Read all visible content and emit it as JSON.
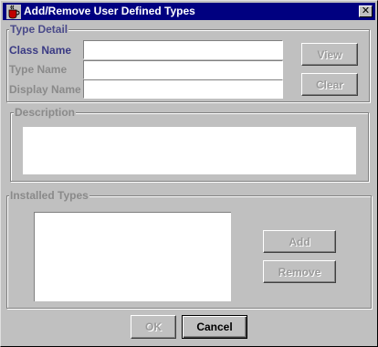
{
  "window": {
    "title": "Add/Remove User Defined Types",
    "close_glyph": "✕"
  },
  "type_detail": {
    "legend": "Type Detail",
    "class_name_label": "Class Name",
    "class_name_value": "",
    "type_name_label": "Type Name",
    "type_name_value": "",
    "display_name_label": "Display Name",
    "display_name_value": "",
    "view_label": "View",
    "clear_label": "Clear"
  },
  "description": {
    "legend": "Description",
    "value": ""
  },
  "installed_types": {
    "legend": "Installed Types",
    "items": [],
    "add_label": "Add",
    "remove_label": "Remove"
  },
  "footer": {
    "ok_label": "OK",
    "cancel_label": "Cancel"
  },
  "colors": {
    "titlebar": "#000080",
    "dialog_bg": "#c0c0c0",
    "active_label": "#3a3a84",
    "disabled_text": "#8a8a8a"
  },
  "icons": {
    "app": "java-cup-icon",
    "close": "close-icon"
  }
}
